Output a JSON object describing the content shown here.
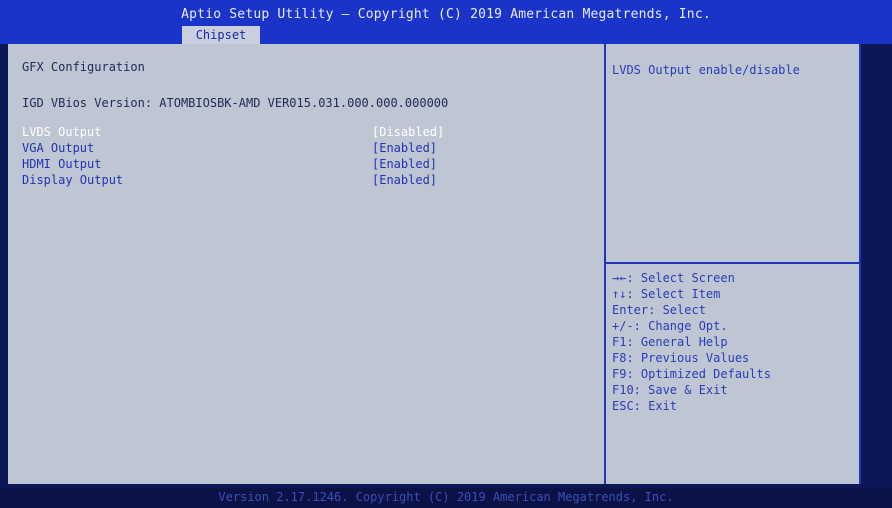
{
  "header": {
    "title": "Aptio Setup Utility – Copyright (C) 2019 American Megatrends, Inc.",
    "active_tab": "Chipset"
  },
  "main": {
    "section_title": "GFX Configuration",
    "vbios_line": "IGD VBios Version: ATOMBIOSBK-AMD VER015.031.000.000.000000",
    "options": [
      {
        "label": "LVDS Output",
        "value": "[Disabled]",
        "selected": true
      },
      {
        "label": "VGA Output",
        "value": "[Enabled]",
        "selected": false
      },
      {
        "label": "HDMI Output",
        "value": "[Enabled]",
        "selected": false
      },
      {
        "label": "Display Output",
        "value": "[Enabled]",
        "selected": false
      }
    ]
  },
  "help": {
    "description": "LVDS Output enable/disable",
    "keys": [
      "→←: Select Screen",
      "↑↓: Select Item",
      "Enter: Select",
      "+/-: Change Opt.",
      "F1: General Help",
      "F8: Previous Values",
      "F9: Optimized Defaults",
      "F10: Save & Exit",
      "ESC: Exit"
    ]
  },
  "footer": {
    "version": "Version 2.17.1246. Copyright (C) 2019 American Megatrends, Inc."
  },
  "colors": {
    "header_bg": "#1a33c8",
    "panel_bg": "#bfc6d3",
    "accent_text": "#2233b0",
    "selected_text": "#ffffff"
  }
}
